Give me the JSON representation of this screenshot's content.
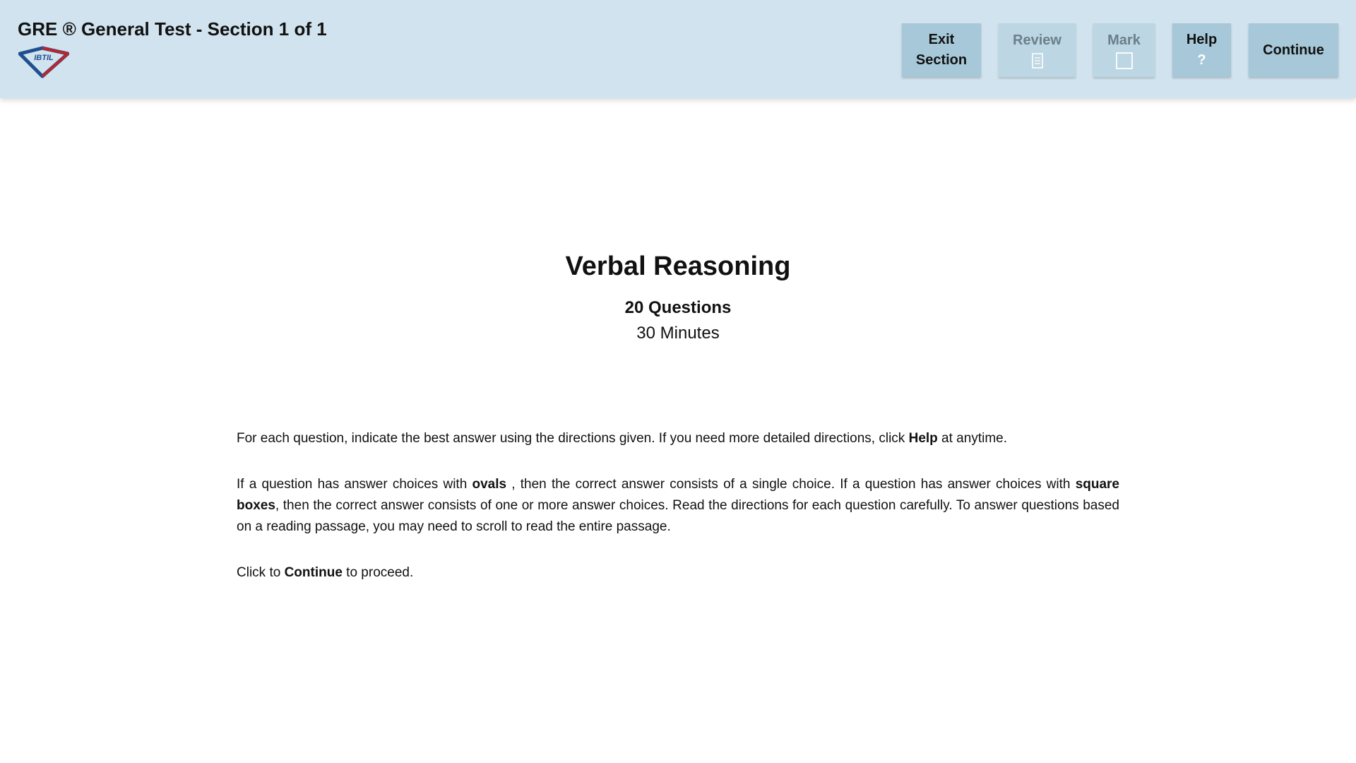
{
  "header": {
    "title": "GRE ® General Test - Section 1 of 1",
    "logo_text": "IBTIL",
    "buttons": {
      "exit_line1": "Exit",
      "exit_line2": "Section",
      "review_label": "Review",
      "mark_label": "Mark",
      "help_label": "Help",
      "help_symbol": "?",
      "continue_label": "Continue"
    },
    "icons": {
      "review": "document-icon",
      "mark": "checkbox-icon"
    }
  },
  "section": {
    "title": "Verbal Reasoning",
    "question_count": "20 Questions",
    "time": "30 Minutes"
  },
  "directions": {
    "p1_before": "For each question, indicate the best answer using the directions given. If you need more detailed directions, click ",
    "p1_bold": "Help",
    "p1_after": " at anytime.",
    "p2_before": "If a question has answer choices with ",
    "p2_bold1": "ovals",
    "p2_mid": " , then the correct answer consists of a single choice. If a question has answer choices with ",
    "p2_bold2": "square boxes",
    "p2_after": ", then the correct answer consists of one or more answer choices. Read the directions for each question carefully. To answer questions based on a reading passage, you may need to scroll to read the entire passage.",
    "p3_before": "Click to ",
    "p3_bold": "Continue",
    "p3_after": " to proceed."
  },
  "colors": {
    "header_bg": "#d1e3ee",
    "button_bg": "#a6c8d8",
    "button_disabled_bg": "#bcd7e3",
    "logo_blue": "#1f4f8f",
    "logo_red": "#b8262e"
  }
}
